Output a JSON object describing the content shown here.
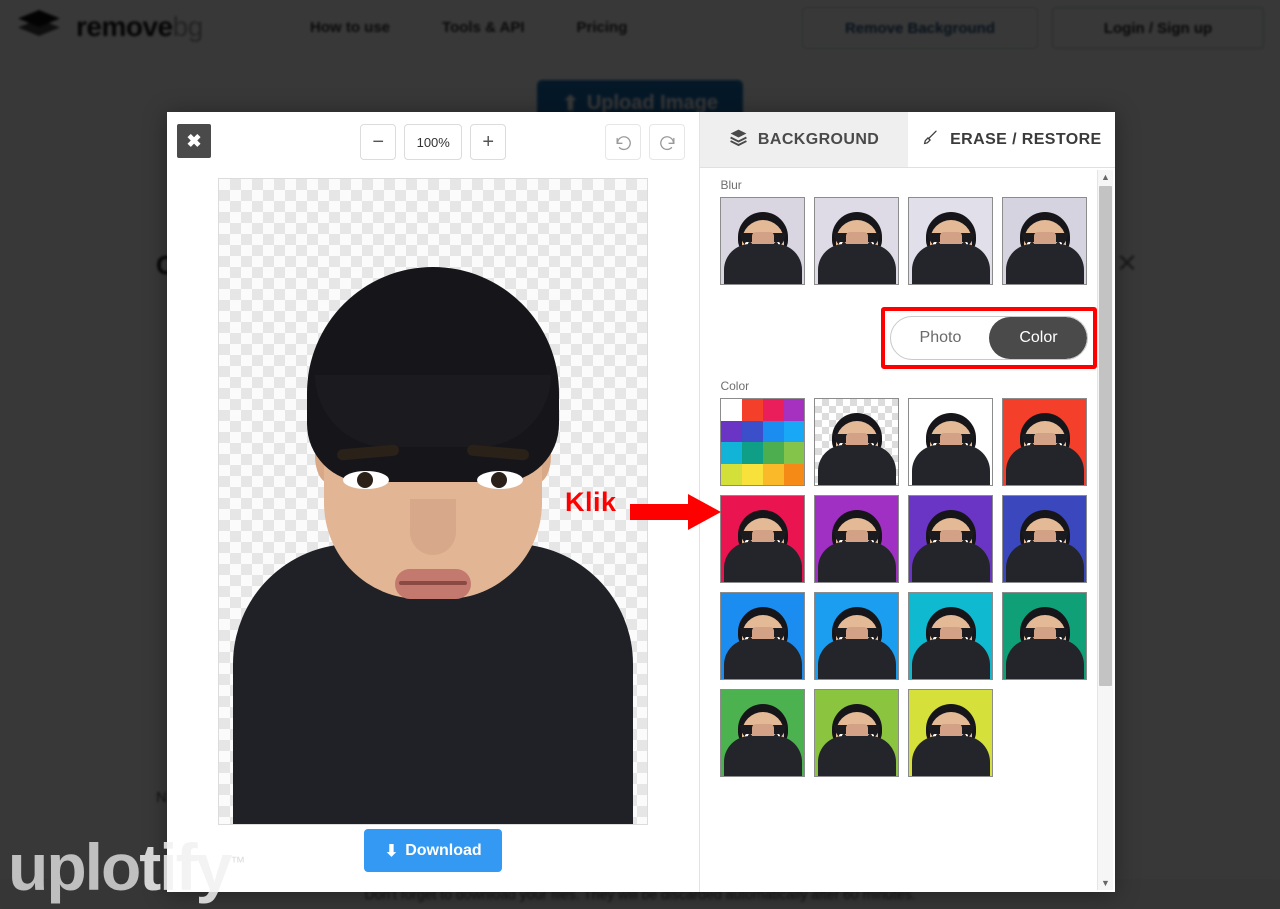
{
  "site": {
    "brand": {
      "name_dark": "remove",
      "name_light": "bg",
      "logo_icon": "layers-icon"
    },
    "nav": [
      {
        "label": "How to use"
      },
      {
        "label": "Tools & API"
      },
      {
        "label": "Pricing"
      }
    ],
    "header_buttons": {
      "remove_background": "Remove Background",
      "login_signup": "Login / Sign up"
    },
    "hero": {
      "upload_label": "Upload Image",
      "upload_icon": "upload-icon",
      "upload_color": "#1a6fb5"
    },
    "result_card": {
      "title": "Original",
      "close_icon": "close-icon",
      "filename": "N"
    },
    "footer_note": "Don't forget to download your files. They will be discarded automatically after 60 minutes.",
    "watermark": {
      "text_dark": "uplo",
      "text_light": "tify",
      "mark": "™"
    }
  },
  "editor": {
    "close_button": {
      "icon": "close-icon",
      "label": "✖"
    },
    "zoom": {
      "minus_label": "−",
      "value": "100%",
      "plus_label": "+",
      "minus_icon": "minus-icon",
      "plus_icon": "plus-icon"
    },
    "history": {
      "undo_icon": "undo-icon",
      "redo_icon": "redo-icon"
    },
    "download": {
      "label": "Download",
      "icon": "download-icon",
      "color": "#3399f3"
    },
    "tabs": [
      {
        "label": "BACKGROUND",
        "icon": "layers-icon",
        "active": false
      },
      {
        "label": "ERASE / RESTORE",
        "icon": "brush-icon",
        "active": true
      }
    ],
    "sections": {
      "blur": {
        "label": "Blur",
        "thumbs": [
          {
            "bg": "#d9d6e2",
            "name": "blur-option-1"
          },
          {
            "bg": "#dedbe6",
            "name": "blur-option-2"
          },
          {
            "bg": "#e1dfe9",
            "name": "blur-option-3"
          },
          {
            "bg": "#d6d3e0",
            "name": "blur-option-4"
          }
        ]
      },
      "mode_toggle": {
        "photo": "Photo",
        "color": "Color",
        "selected": "Color",
        "highlight_color": "#ff0000"
      },
      "color": {
        "label": "Color",
        "picker_swatches": [
          "#ffffff",
          "#f4402a",
          "#ea1e5a",
          "#a630bf",
          "#6a35c4",
          "#3a4fc9",
          "#1b8df0",
          "#18a8f5",
          "#11b4d6",
          "#0f9e86",
          "#4cae4f",
          "#85c44a",
          "#d4e03a",
          "#f9e13b",
          "#f9b928",
          "#f58a16"
        ],
        "thumbs": [
          {
            "bg": "transparent",
            "name": "color-picker-swatch"
          },
          {
            "bg": "checker",
            "name": "color-transparent"
          },
          {
            "bg": "#ffffff",
            "name": "color-white"
          },
          {
            "bg": "#f4402a",
            "name": "color-red-orange"
          },
          {
            "bg": "#ea1450",
            "name": "color-pink"
          },
          {
            "bg": "#a02fc4",
            "name": "color-purple"
          },
          {
            "bg": "#6a35c4",
            "name": "color-violet"
          },
          {
            "bg": "#3a47bd",
            "name": "color-indigo"
          },
          {
            "bg": "#1b8df0",
            "name": "color-blue"
          },
          {
            "bg": "#1b9ef0",
            "name": "color-sky-blue"
          },
          {
            "bg": "#0fb9cf",
            "name": "color-cyan"
          },
          {
            "bg": "#10a077",
            "name": "color-teal"
          },
          {
            "bg": "#4cb14f",
            "name": "color-green"
          },
          {
            "bg": "#8bc53f",
            "name": "color-light-green"
          },
          {
            "bg": "#d5e03a",
            "name": "color-lime"
          }
        ]
      }
    },
    "scrollbar": {
      "up_icon": "chevron-up-icon",
      "down_icon": "chevron-down-icon"
    }
  },
  "annotation": {
    "text": "Klik",
    "color": "#ff0000",
    "arrow_icon": "arrow-right-icon"
  }
}
